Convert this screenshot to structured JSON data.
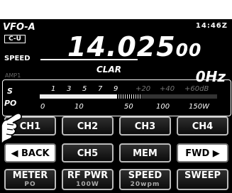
{
  "display": {
    "vfo": "VFO-A",
    "mode_tag": "C-U",
    "clock": "14:46Z",
    "frequency_main": "14.025",
    "frequency_small": "00",
    "speed_label": "SPEED",
    "amp_label": "AMP1",
    "clar_label": "CLAR",
    "clar_offset": "0Hz"
  },
  "meter": {
    "s_label": "S",
    "po_label": "PO",
    "s_ticks": [
      "1",
      "3",
      "5",
      "7",
      "9",
      "+20",
      "+40",
      "+60dB"
    ],
    "po_ticks": [
      "0",
      "10",
      "50",
      "100",
      "150W"
    ],
    "po_level_fraction": 0.43
  },
  "buttons": {
    "ch1": "CH1",
    "ch2": "CH2",
    "ch3": "CH3",
    "ch4": "CH4",
    "back": "BACK",
    "ch5": "CH5",
    "mem": "MEM",
    "fwd": "FWD",
    "meter": "METER",
    "meter_value": "PO",
    "rf_pwr": "RF PWR",
    "rf_pwr_value": "100W",
    "speed": "SPEED",
    "speed_value": "20wpm",
    "sweep": "SWEEP"
  }
}
